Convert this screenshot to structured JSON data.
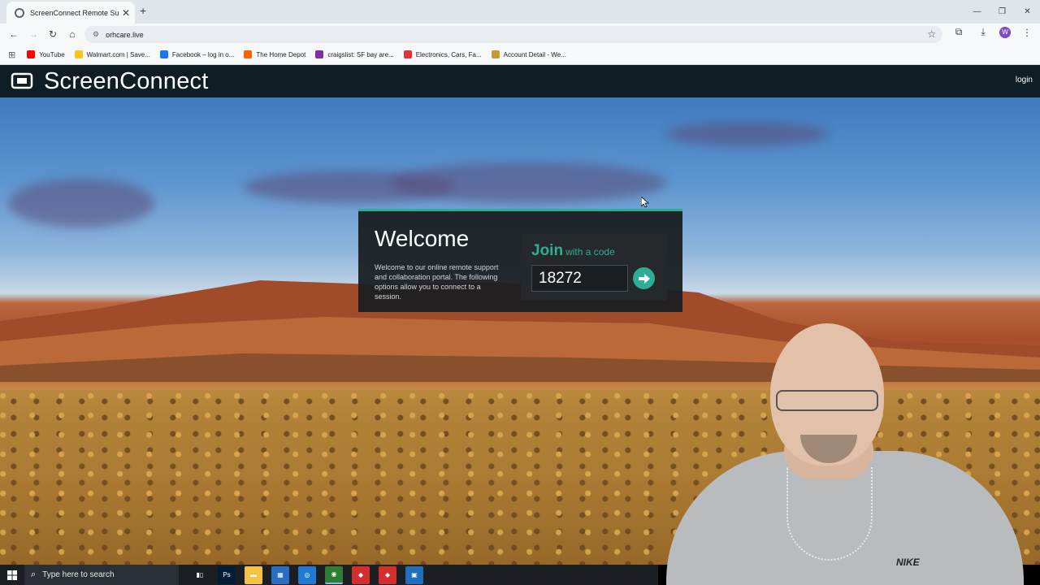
{
  "browser": {
    "tab_title": "ScreenConnect Remote Suppor",
    "url": "orhcare.live",
    "profile_initial": "W",
    "bookmarks": [
      {
        "label": "YouTube",
        "color": "#ff0000"
      },
      {
        "label": "Walmart.com | Save...",
        "color": "#ffc220"
      },
      {
        "label": "Facebook – log in o...",
        "color": "#1877f2"
      },
      {
        "label": "The Home Depot",
        "color": "#f96302"
      },
      {
        "label": "craigslist: SF bay are...",
        "color": "#7e2fa2"
      },
      {
        "label": "Electronics, Cars, Fa...",
        "color": "#e53238"
      },
      {
        "label": "Account Detail - We...",
        "color": "#c49a3a"
      }
    ]
  },
  "header": {
    "brand": "ScreenConnect",
    "login_label": "login"
  },
  "welcome": {
    "title": "Welcome",
    "description": "Welcome to our online remote support and collaboration portal. The following options allow you to connect to a session.",
    "join_word": "Join",
    "join_sub": "with a code",
    "code_value": "18272"
  },
  "taskbar": {
    "search_placeholder": "Type here to search",
    "apps": [
      {
        "name": "task-view",
        "label": "▮▯",
        "color": "#1b1f24"
      },
      {
        "name": "photoshop",
        "label": "Ps",
        "color": "#001e36"
      },
      {
        "name": "file-explorer",
        "label": "▬",
        "color": "#f5c242"
      },
      {
        "name": "store",
        "label": "▦",
        "color": "#2b6cc4"
      },
      {
        "name": "edge",
        "label": "◎",
        "color": "#1e7ad4"
      },
      {
        "name": "chrome",
        "label": "◉",
        "color": "#2e7d32"
      },
      {
        "name": "anydesk-1",
        "label": "◆",
        "color": "#d32f2f"
      },
      {
        "name": "anydesk-2",
        "label": "◆",
        "color": "#d32f2f"
      },
      {
        "name": "screenconnect-app",
        "label": "▣",
        "color": "#1f6fbf"
      }
    ]
  },
  "theme": {
    "accent": "#2fae96",
    "header_bg": "#0f1e24"
  }
}
